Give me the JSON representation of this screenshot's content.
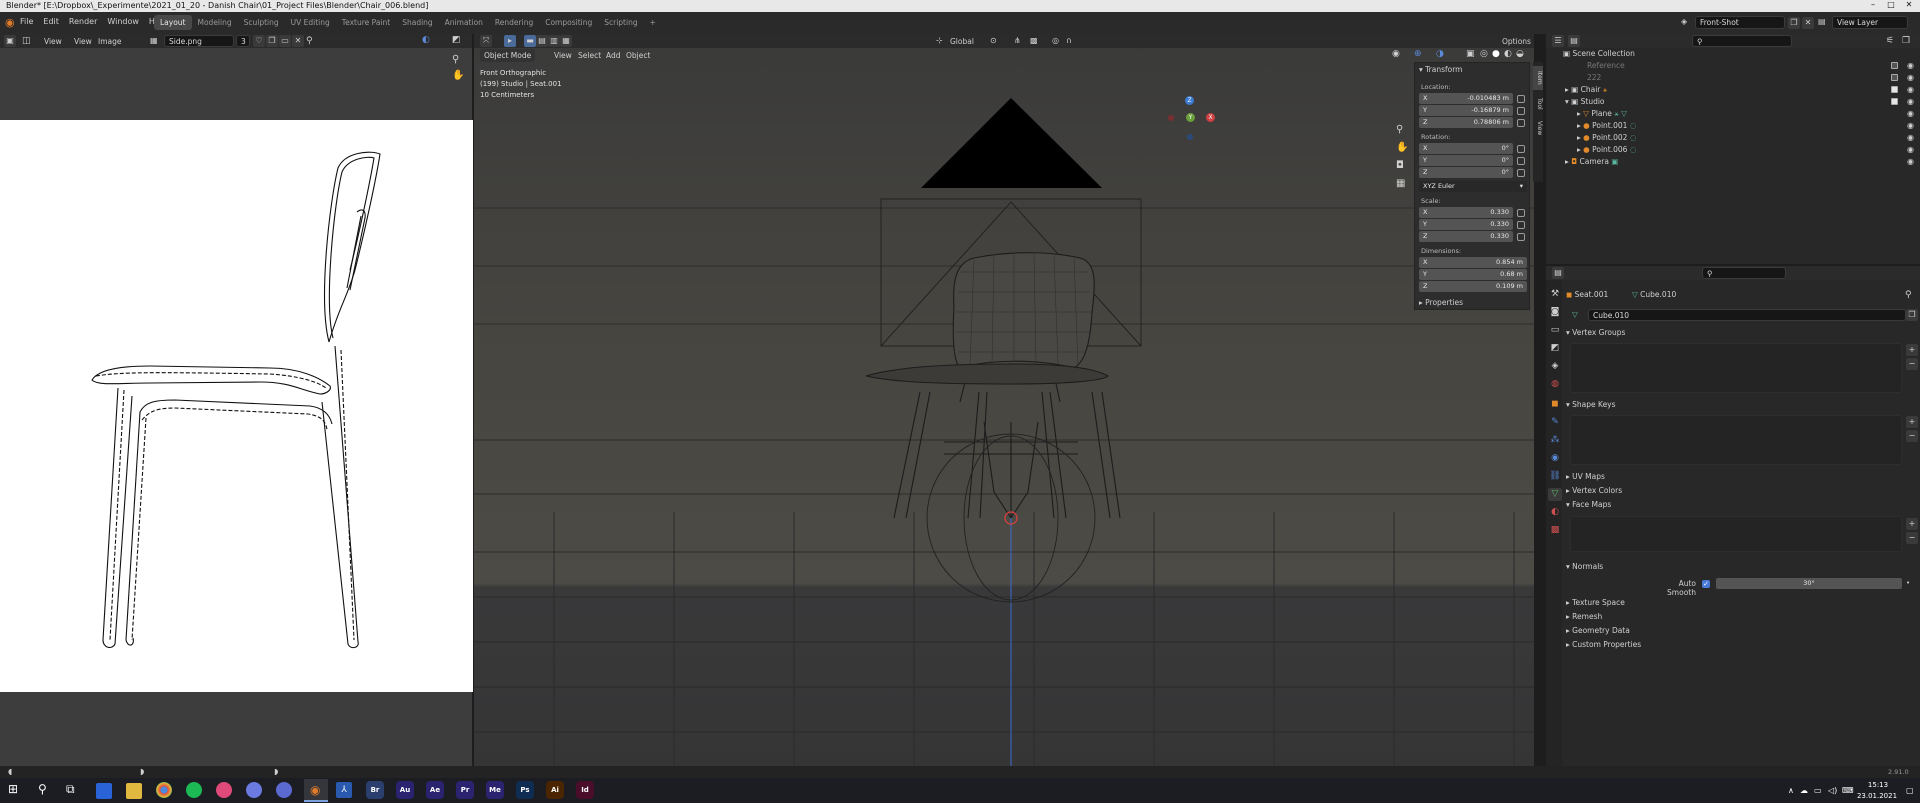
{
  "window": {
    "title": "Blender* [E:\\Dropbox\\_Experimente\\2021_01_20 - Danish Chair\\01_Project Files\\Blender\\Chair_006.blend]",
    "minimize": "–",
    "maximize": "□",
    "close": "✕"
  },
  "menus": [
    "File",
    "Edit",
    "Render",
    "Window",
    "Help"
  ],
  "workspaces": [
    "Layout",
    "Modeling",
    "Sculpting",
    "UV Editing",
    "Texture Paint",
    "Shading",
    "Animation",
    "Rendering",
    "Compositing",
    "Scripting"
  ],
  "active_workspace": "Layout",
  "add_workspace": "+",
  "scene": {
    "name": "Front-Shot",
    "view_layer": "View Layer"
  },
  "image_editor": {
    "menus": [
      "View",
      "View",
      "Image"
    ],
    "image_name": "Side.png",
    "users": "3"
  },
  "viewport": {
    "mode": "Object Mode",
    "menus": [
      "View",
      "Select",
      "Add",
      "Object"
    ],
    "info_line1": "Front Orthographic",
    "info_line2": "(199) Studio | Seat.001",
    "info_line3": "10 Centimeters",
    "orientation": "Global",
    "options_label": "Options",
    "gizmo": {
      "x": "X",
      "y": "Y",
      "z": "Z"
    }
  },
  "n_panel": {
    "section": "Transform",
    "location_label": "Location:",
    "location": [
      {
        "axis": "X",
        "value": "-0.010483 m"
      },
      {
        "axis": "Y",
        "value": "-0.16879 m"
      },
      {
        "axis": "Z",
        "value": "0.78806 m"
      }
    ],
    "rotation_label": "Rotation:",
    "rotation": [
      {
        "axis": "X",
        "value": "0°"
      },
      {
        "axis": "Y",
        "value": "0°"
      },
      {
        "axis": "Z",
        "value": "0°"
      }
    ],
    "euler": "XYZ Euler",
    "scale_label": "Scale:",
    "scale": [
      {
        "axis": "X",
        "value": "0.330"
      },
      {
        "axis": "Y",
        "value": "0.330"
      },
      {
        "axis": "Z",
        "value": "0.330"
      }
    ],
    "dimensions_label": "Dimensions:",
    "dimensions": [
      {
        "axis": "X",
        "value": "0.854 m"
      },
      {
        "axis": "Y",
        "value": "0.68 m"
      },
      {
        "axis": "Z",
        "value": "0.109 m"
      }
    ],
    "properties": "Properties",
    "tabs": [
      "Item",
      "Tool",
      "View"
    ]
  },
  "outliner": {
    "rows": [
      "Scene Collection",
      "Reference",
      "222",
      "Chair",
      "Studio",
      "Plane",
      "Point.001",
      "Point.002",
      "Point.006",
      "Camera"
    ]
  },
  "properties": {
    "object": "Seat.001",
    "mesh": "Cube.010",
    "datablock": "Cube.010",
    "sections": [
      "Vertex Groups",
      "Shape Keys",
      "UV Maps",
      "Vertex Colors",
      "Face Maps",
      "Normals",
      "Texture Space",
      "Remesh",
      "Geometry Data",
      "Custom Properties"
    ],
    "auto_smooth_label": "Auto Smooth",
    "auto_smooth_angle": "30°"
  },
  "status": {
    "version": "2.91.0"
  },
  "taskbar": {
    "apps": [
      {
        "label": "Br",
        "color": "#2a3f6e"
      },
      {
        "label": "Au",
        "color": "#2b2270"
      },
      {
        "label": "Ae",
        "color": "#2b2270"
      },
      {
        "label": "Pr",
        "color": "#2b2270"
      },
      {
        "label": "Me",
        "color": "#2b2270"
      },
      {
        "label": "Ps",
        "color": "#0f2d52"
      },
      {
        "label": "Ai",
        "color": "#4b2500"
      },
      {
        "label": "Id",
        "color": "#4a0e2a"
      }
    ],
    "time": "15:13",
    "date": "23.01.2021"
  }
}
